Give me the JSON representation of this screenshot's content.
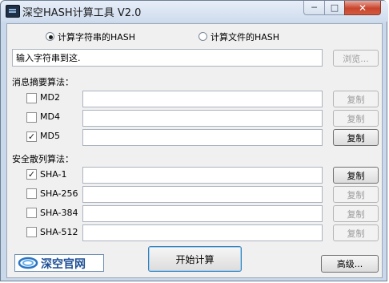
{
  "window": {
    "title": "深空HASH计算工具 V2.0",
    "controls": {
      "minimize": "─",
      "maximize": "□",
      "close": "✕"
    }
  },
  "mode": {
    "string_label": "计算字符串的HASH",
    "file_label": "计算文件的HASH",
    "selected": "string"
  },
  "input": {
    "value": "输入字符串到这.",
    "browse_label": "浏览..."
  },
  "digest": {
    "section_label": "消息摘要算法：",
    "items": [
      {
        "name": "MD2",
        "checked": false,
        "copy_label": "复制",
        "copy_enabled": false,
        "output": ""
      },
      {
        "name": "MD4",
        "checked": false,
        "copy_label": "复制",
        "copy_enabled": false,
        "output": ""
      },
      {
        "name": "MD5",
        "checked": true,
        "copy_label": "复制",
        "copy_enabled": true,
        "output": ""
      }
    ]
  },
  "sha": {
    "section_label": "安全散列算法：",
    "items": [
      {
        "name": "SHA-1",
        "checked": true,
        "copy_label": "复制",
        "copy_enabled": true,
        "output": ""
      },
      {
        "name": "SHA-256",
        "checked": false,
        "copy_label": "复制",
        "copy_enabled": false,
        "output": ""
      },
      {
        "name": "SHA-384",
        "checked": false,
        "copy_label": "复制",
        "copy_enabled": false,
        "output": ""
      },
      {
        "name": "SHA-512",
        "checked": false,
        "copy_label": "复制",
        "copy_enabled": false,
        "output": ""
      }
    ]
  },
  "footer": {
    "logo_text": "深空官网",
    "start_label": "开始计算",
    "advanced_label": "高级..."
  },
  "colors": {
    "logo_blue": "#1d4f96",
    "close_red": "#c8452c"
  }
}
